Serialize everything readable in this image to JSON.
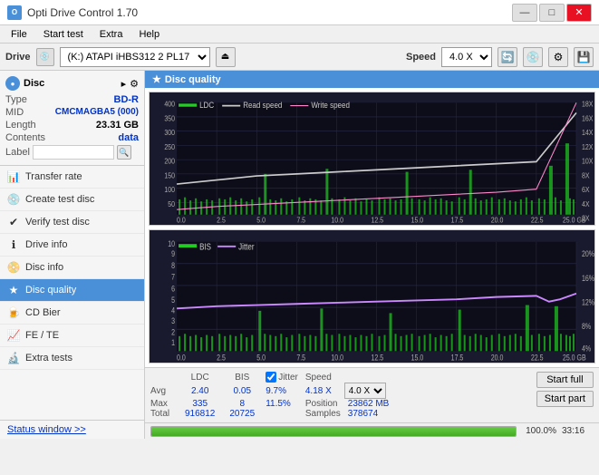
{
  "window": {
    "title": "Opti Drive Control 1.70",
    "minimize": "—",
    "maximize": "□",
    "close": "✕"
  },
  "menu": {
    "items": [
      "File",
      "Start test",
      "Extra",
      "Help"
    ]
  },
  "drive_bar": {
    "label": "Drive",
    "drive_value": "(K:)  ATAPI iHBS312  2 PL17",
    "speed_label": "Speed",
    "speed_value": "4.0 X"
  },
  "disc_panel": {
    "title": "Disc",
    "type_label": "Type",
    "type_value": "BD-R",
    "mid_label": "MID",
    "mid_value": "CMCMAGBA5 (000)",
    "length_label": "Length",
    "length_value": "23.31 GB",
    "contents_label": "Contents",
    "contents_value": "data",
    "label_label": "Label",
    "label_placeholder": ""
  },
  "nav": {
    "items": [
      {
        "id": "transfer-rate",
        "label": "Transfer rate",
        "icon": "📊"
      },
      {
        "id": "create-test-disc",
        "label": "Create test disc",
        "icon": "💿"
      },
      {
        "id": "verify-test-disc",
        "label": "Verify test disc",
        "icon": "✔"
      },
      {
        "id": "drive-info",
        "label": "Drive info",
        "icon": "ℹ"
      },
      {
        "id": "disc-info",
        "label": "Disc info",
        "icon": "📀"
      },
      {
        "id": "disc-quality",
        "label": "Disc quality",
        "icon": "★",
        "active": true
      },
      {
        "id": "cd-bier",
        "label": "CD Bier",
        "icon": "🍺"
      },
      {
        "id": "fe-te",
        "label": "FE / TE",
        "icon": "📈"
      },
      {
        "id": "extra-tests",
        "label": "Extra tests",
        "icon": "🔬"
      }
    ],
    "status_window": "Status window >>"
  },
  "chart1": {
    "title": "Disc quality",
    "legend": {
      "ldc": "LDC",
      "read_speed": "Read speed",
      "write_speed": "Write speed"
    },
    "y_axis_labels": [
      "18X",
      "16X",
      "14X",
      "12X",
      "10X",
      "8X",
      "6X",
      "4X",
      "2X"
    ],
    "y_axis_left": [
      "400",
      "350",
      "300",
      "250",
      "200",
      "150",
      "100",
      "50"
    ],
    "x_axis": [
      "0.0",
      "2.5",
      "5.0",
      "7.5",
      "10.0",
      "12.5",
      "15.0",
      "17.5",
      "20.0",
      "22.5",
      "25.0 GB"
    ]
  },
  "chart2": {
    "legend": {
      "bis": "BIS",
      "jitter": "Jitter"
    },
    "y_axis_labels": [
      "20%",
      "16%",
      "12%",
      "8%",
      "4%"
    ],
    "y_axis_left": [
      "10",
      "9",
      "8",
      "7",
      "6",
      "5",
      "4",
      "3",
      "2",
      "1"
    ],
    "x_axis": [
      "0.0",
      "2.5",
      "5.0",
      "7.5",
      "10.0",
      "12.5",
      "15.0",
      "17.5",
      "20.0",
      "22.5",
      "25.0 GB"
    ]
  },
  "stats": {
    "ldc_label": "LDC",
    "bis_label": "BIS",
    "jitter_label": "Jitter",
    "speed_label": "Speed",
    "position_label": "Position",
    "samples_label": "Samples",
    "avg_label": "Avg",
    "max_label": "Max",
    "total_label": "Total",
    "ldc_avg": "2.40",
    "ldc_max": "335",
    "ldc_total": "916812",
    "bis_avg": "0.05",
    "bis_max": "8",
    "bis_total": "20725",
    "jitter_avg": "9.7%",
    "jitter_max": "11.5%",
    "speed_value": "4.18 X",
    "speed_select": "4.0 X",
    "position_value": "23862 MB",
    "samples_value": "378674",
    "start_full_label": "Start full",
    "start_part_label": "Start part"
  },
  "progress": {
    "percent": "100.0%",
    "time": "33:16",
    "bar_width": "100"
  }
}
